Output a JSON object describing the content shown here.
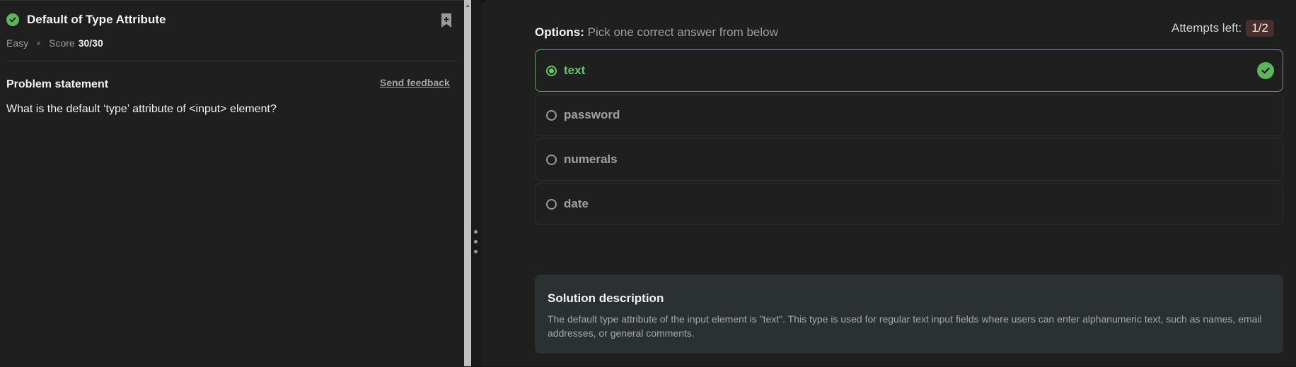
{
  "problem": {
    "title": "Default of Type Attribute",
    "difficulty": "Easy",
    "score_label": "Score",
    "score_value": "30/30",
    "section_heading": "Problem statement",
    "send_feedback": "Send feedback",
    "statement": "What is the default ‘type’ attribute of <input> element?"
  },
  "options": {
    "label_bold": "Options:",
    "label_rest": " Pick one correct answer from below",
    "attempts_label": "Attempts left:",
    "attempts_value": "1/2",
    "items": [
      {
        "label": "text",
        "state": "correct-selected"
      },
      {
        "label": "password",
        "state": "unselected"
      },
      {
        "label": "numerals",
        "state": "unselected"
      },
      {
        "label": "date",
        "state": "unselected"
      }
    ]
  },
  "solution": {
    "title": "Solution description",
    "text": "The default type attribute of the input element is \"text\". This type is used for regular text input fields where users can enter alphanumeric text, such as names, email addresses, or general comments."
  },
  "icons": {
    "status": "check-circle-icon",
    "bookmark": "bookmark-add-icon",
    "correct": "check-circle-icon"
  },
  "colors": {
    "accent_green": "#5fb55f",
    "attempts_badge": "#4a2e2e",
    "solution_bg": "#2b3033"
  }
}
